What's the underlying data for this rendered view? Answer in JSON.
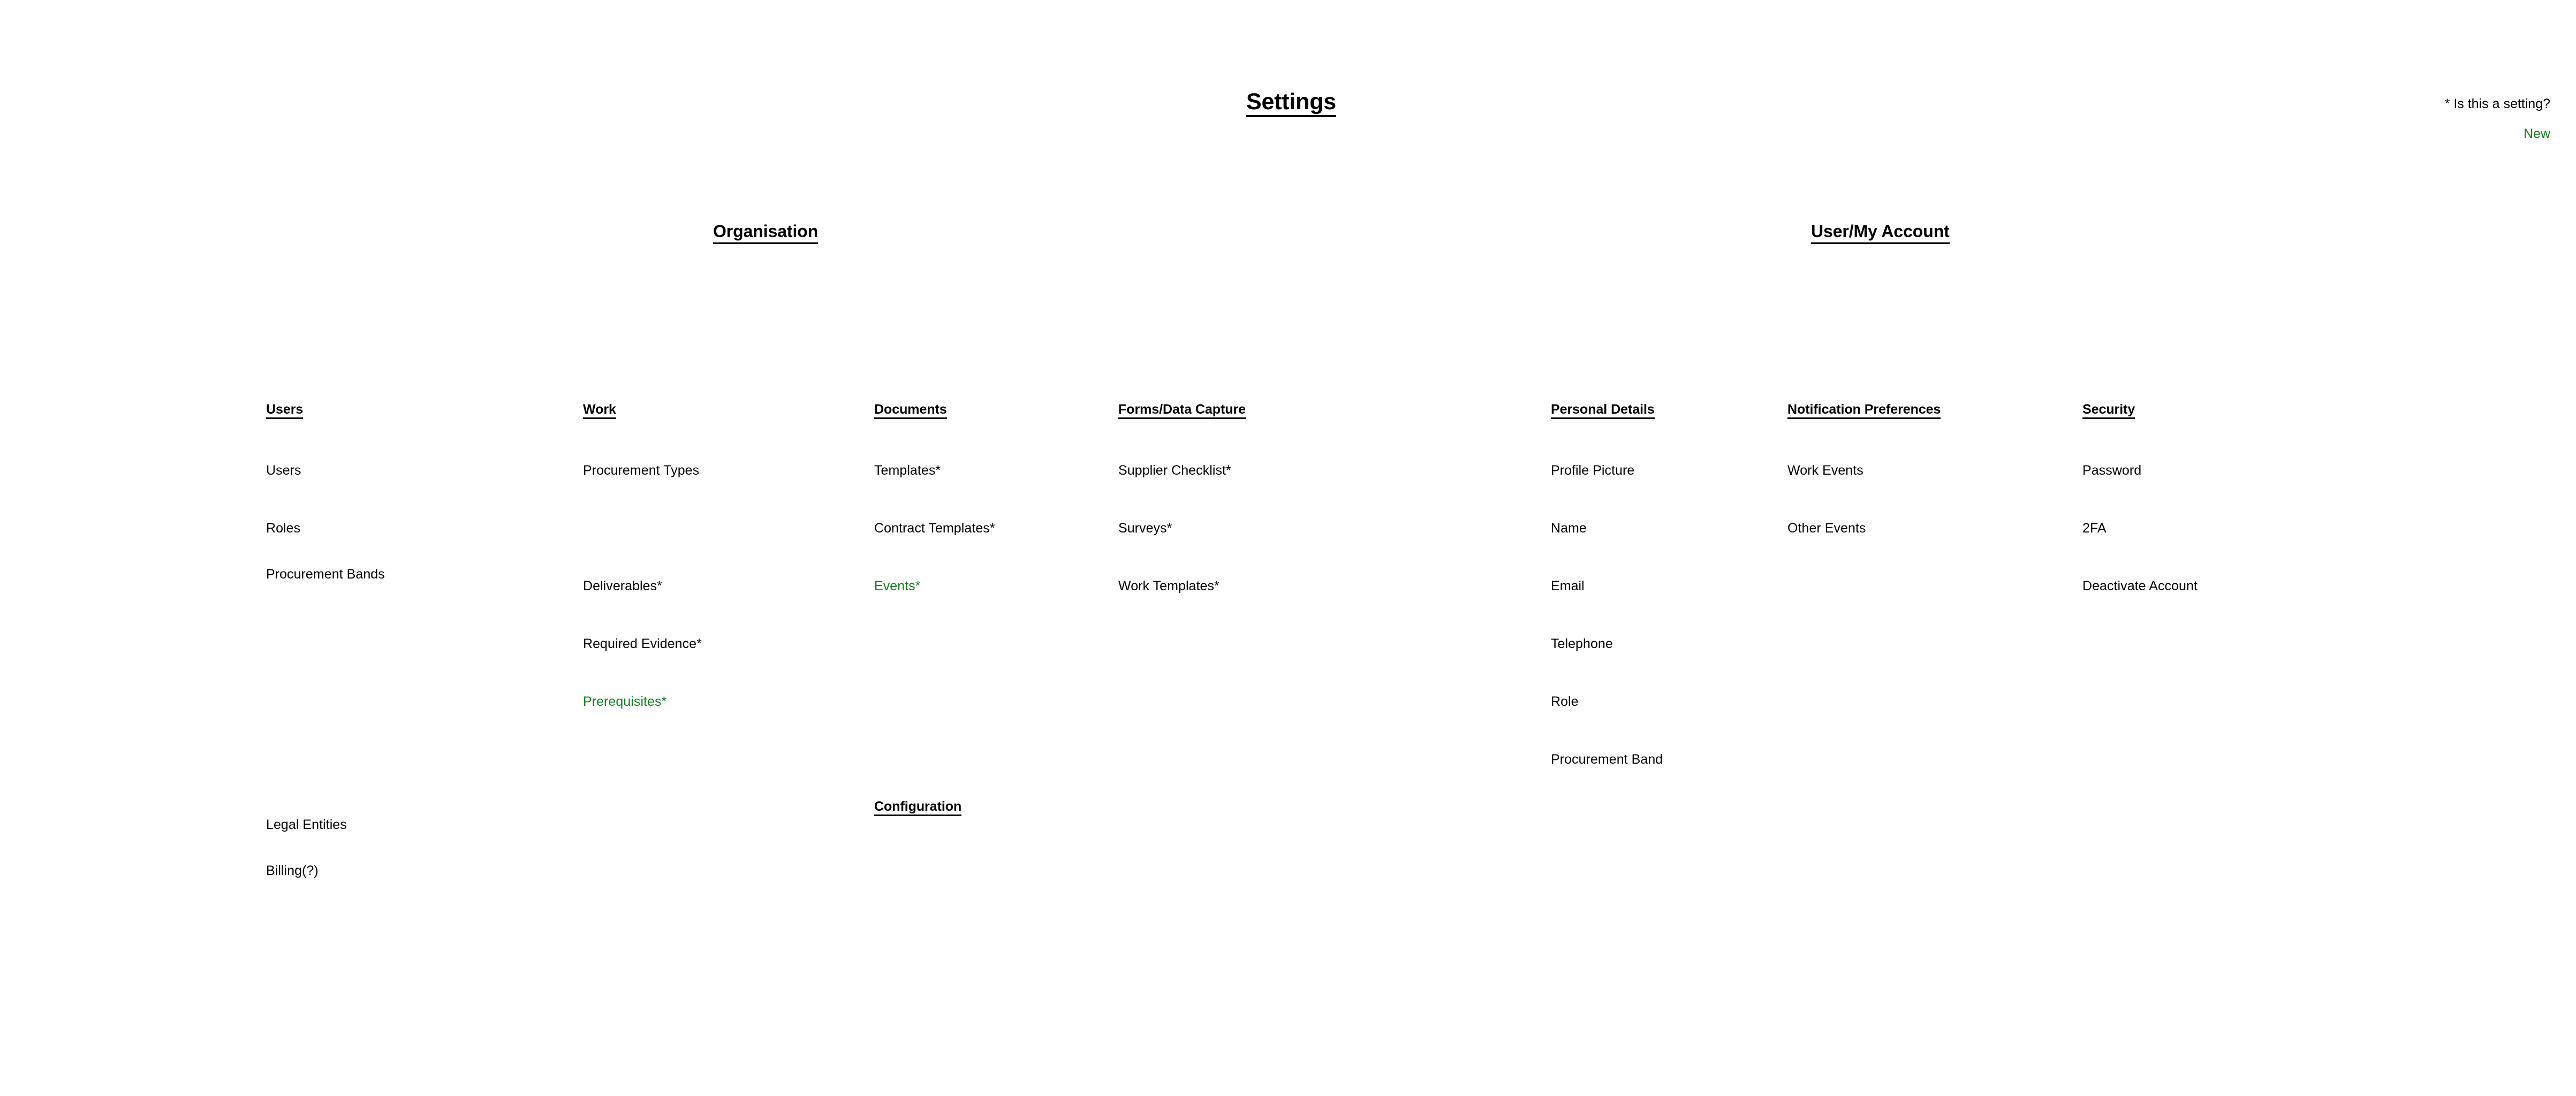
{
  "page": {
    "title": "Settings"
  },
  "legend": {
    "setting_note": "* Is this a setting?",
    "new_note": "New"
  },
  "colors": {
    "text": "#000000",
    "new": "#14801e",
    "background": "#ffffff"
  },
  "sections": {
    "organisation": {
      "title": "Organisation"
    },
    "user_account": {
      "title": "User/My Account"
    }
  },
  "columns": {
    "users": {
      "header": "Users",
      "items": [
        {
          "label": "Users",
          "new": false,
          "row": 1
        },
        {
          "label": "Roles",
          "new": false,
          "row": 2
        },
        {
          "label": "Procurement Bands",
          "new": false,
          "row": 3
        },
        {
          "label": "Legal Entities",
          "new": false,
          "row": 8
        },
        {
          "label": "Billing(?)",
          "new": false,
          "row": 9
        }
      ]
    },
    "work": {
      "header": "Work",
      "items": [
        {
          "label": "Procurement Types",
          "new": false,
          "row": 1
        },
        {
          "label": "Deliverables*",
          "new": false,
          "row": 4
        },
        {
          "label": "Required Evidence*",
          "new": false,
          "row": 5
        },
        {
          "label": "Prerequisites*",
          "new": true,
          "row": 6
        }
      ]
    },
    "documents": {
      "header": "Documents",
      "items": [
        {
          "label": "Templates*",
          "new": false,
          "row": 1
        },
        {
          "label": "Contract Templates*",
          "new": false,
          "row": 2
        },
        {
          "label": "Events*",
          "new": true,
          "row": 4
        }
      ],
      "sub_header": "Configuration"
    },
    "forms_data_capture": {
      "header": "Forms/Data Capture",
      "items": [
        {
          "label": "Supplier Checklist*",
          "new": false,
          "row": 1
        },
        {
          "label": "Surveys*",
          "new": false,
          "row": 2
        },
        {
          "label": "Work Templates*",
          "new": false,
          "row": 4
        }
      ]
    },
    "personal_details": {
      "header": "Personal Details",
      "items": [
        {
          "label": "Profile Picture",
          "new": false,
          "row": 1
        },
        {
          "label": "Name",
          "new": false,
          "row": 2
        },
        {
          "label": "Email",
          "new": false,
          "row": 3
        },
        {
          "label": "Telephone",
          "new": false,
          "row": 4
        },
        {
          "label": "Role",
          "new": false,
          "row": 5
        },
        {
          "label": "Procurement Band",
          "new": false,
          "row": 6
        }
      ]
    },
    "notification_preferences": {
      "header": "Notification Preferences",
      "items": [
        {
          "label": "Work Events",
          "new": false,
          "row": 1
        },
        {
          "label": "Other Events",
          "new": false,
          "row": 2
        }
      ]
    },
    "security": {
      "header": "Security",
      "items": [
        {
          "label": "Password",
          "new": false,
          "row": 1
        },
        {
          "label": "2FA",
          "new": false,
          "row": 2
        },
        {
          "label": "Deactivate Account",
          "new": false,
          "row": 3
        }
      ]
    }
  }
}
